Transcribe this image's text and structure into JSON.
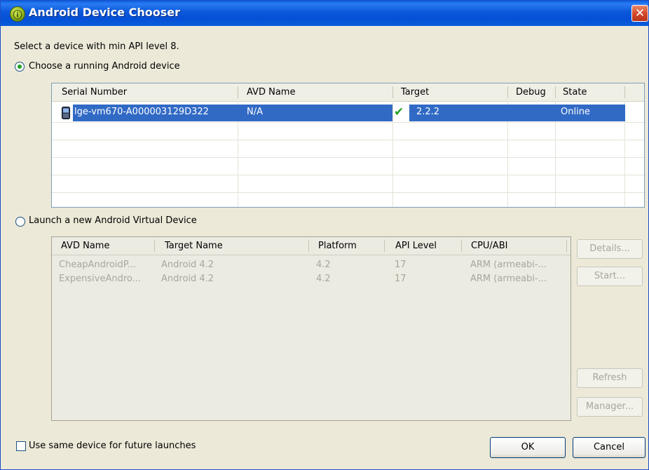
{
  "window": {
    "title": "Android Device Chooser",
    "app_icon": "android-icon",
    "close_icon": "close-icon",
    "close_glyph": "✕"
  },
  "intro": "Select a device with min API level 8.",
  "running": {
    "radio_label": "Choose a running Android device",
    "selected": true,
    "columns": [
      "Serial Number",
      "AVD Name",
      "Target",
      "Debug",
      "State"
    ],
    "rows": [
      {
        "serial": "lge-vm670-A000003129D322",
        "avd_name": "N/A",
        "target": "2.2.2",
        "target_ok": "✔",
        "debug": "",
        "state": "Online",
        "device_icon": "phone-icon"
      }
    ]
  },
  "launch": {
    "radio_label": "Launch a new Android Virtual Device",
    "selected": false,
    "columns": [
      "AVD Name",
      "Target Name",
      "Platform",
      "API Level",
      "CPU/ABI"
    ],
    "rows": [
      {
        "avd_name": "CheapAndroidP...",
        "target_name": "Android 4.2",
        "platform": "4.2",
        "api_level": "17",
        "cpu_abi": "ARM (armeabi-..."
      },
      {
        "avd_name": "ExpensiveAndro...",
        "target_name": "Android 4.2",
        "platform": "4.2",
        "api_level": "17",
        "cpu_abi": "ARM (armeabi-..."
      }
    ],
    "buttons": {
      "details": "Details...",
      "start": "Start...",
      "refresh": "Refresh",
      "manager": "Manager..."
    }
  },
  "footer": {
    "same_device_label": "Use same device for future launches",
    "same_device_checked": false,
    "ok": "OK",
    "cancel": "Cancel"
  },
  "colors": {
    "selection": "#316ac5",
    "titlebar": "#0a5ee3",
    "check": "#21a121"
  }
}
